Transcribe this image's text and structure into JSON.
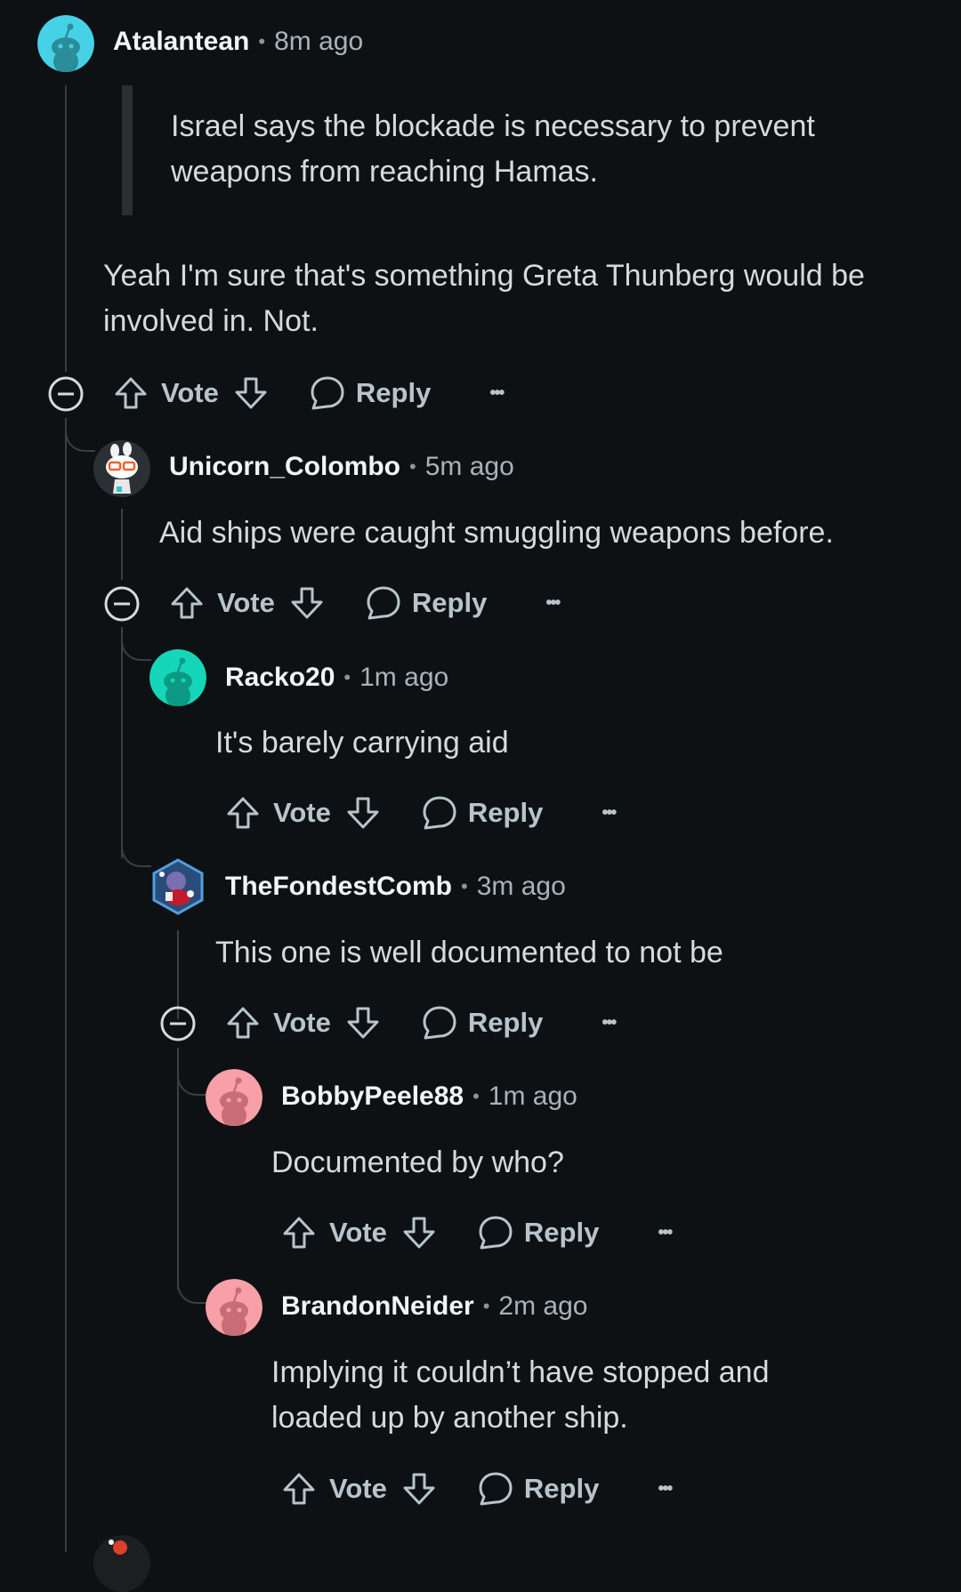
{
  "comments": [
    {
      "id": "c1",
      "user": "Atalantean",
      "time": "8m ago",
      "quote": "Israel says the blockade is necessary to prevent weapons from reaching Hamas.",
      "text": "Yeah I'm sure that's something Greta Thunberg would be involved in. Not.",
      "avatar_color": "#46d1e6"
    },
    {
      "id": "c2",
      "user": "Unicorn_Colombo",
      "time": "5m ago",
      "text": "Aid ships were caught smuggling weapons before.",
      "avatar_color": "#ffffff"
    },
    {
      "id": "c3",
      "user": "Racko20",
      "time": "1m ago",
      "text": "It's barely carrying aid",
      "avatar_color": "#15d6b8"
    },
    {
      "id": "c4",
      "user": "TheFondestComb",
      "time": "3m ago",
      "text": "This one is well documented to not be",
      "avatar_color": "#3a6fb0"
    },
    {
      "id": "c5",
      "user": "BobbyPeele88",
      "time": "1m ago",
      "text": "Documented by who?",
      "avatar_color": "#f7a0a8"
    },
    {
      "id": "c6",
      "user": "BrandonNeider",
      "time": "2m ago",
      "text": "Implying it couldn’t have stopped and loaded up by another ship.",
      "avatar_color": "#f7a0a8"
    }
  ],
  "actions": {
    "vote_label": "Vote",
    "reply_label": "Reply",
    "more_label": "•••"
  },
  "colors": {
    "background": "#0e1113",
    "thread_line": "#3a3f44",
    "action_text": "#b8c4cb"
  }
}
